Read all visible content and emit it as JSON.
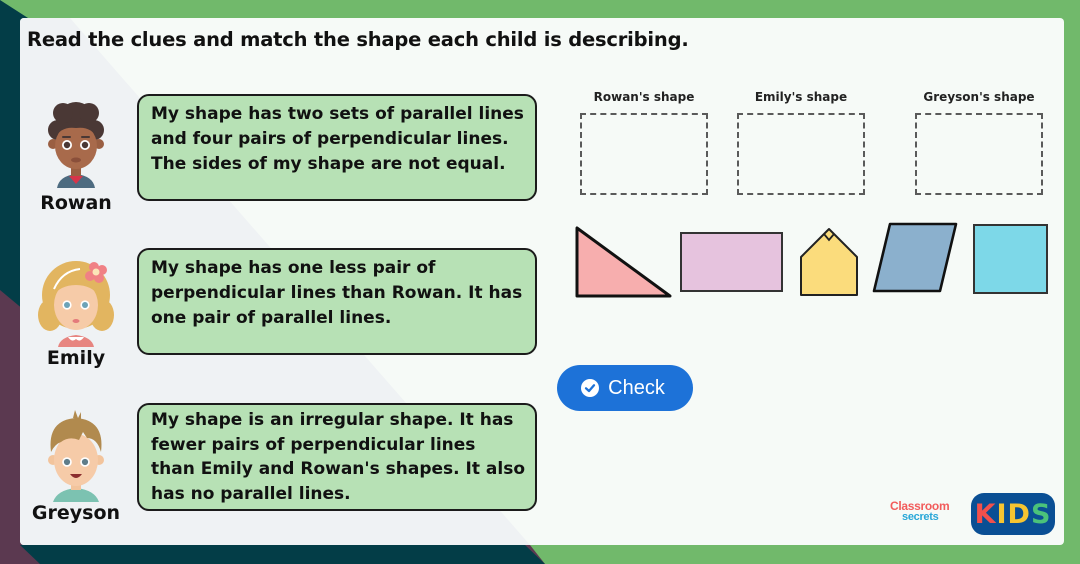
{
  "colors": {
    "frame_green": "#71b96b",
    "frame_teal": "#033d47",
    "frame_plum": "#5b3950",
    "card_bg": "#f6faf7",
    "bubble_bg": "#b7e1b5",
    "check_button": "#1d72d8"
  },
  "title": "Read the clues and match the shape each child is describing.",
  "children": [
    {
      "name": "Rowan",
      "clue": "My shape has two sets of parallel lines and four pairs of perpendicular lines. The sides of my shape are not equal."
    },
    {
      "name": "Emily",
      "clue": "My shape has one less pair of perpendicular lines than Rowan. It has one pair of parallel lines."
    },
    {
      "name": "Greyson",
      "clue": "My shape is an irregular shape. It has fewer pairs of perpendicular lines than Emily and Rowan's shapes. It also has no parallel lines."
    }
  ],
  "drop_slots": [
    {
      "label": "Rowan's shape"
    },
    {
      "label": "Emily's shape"
    },
    {
      "label": "Greyson's shape"
    }
  ],
  "shapes": [
    {
      "name": "right-angled triangle",
      "fill": "#f7aeae"
    },
    {
      "name": "rectangle",
      "fill": "#e6c3de"
    },
    {
      "name": "irregular pentagon",
      "fill": "#fbdc7c"
    },
    {
      "name": "parallelogram",
      "fill": "#8bb0cd"
    },
    {
      "name": "square",
      "fill": "#7dd8e8"
    }
  ],
  "check_button": {
    "label": "Check",
    "icon": "check-circle-icon"
  },
  "branding": {
    "line1": "Classroom",
    "line2": "secrets",
    "kids_letters": [
      {
        "char": "K",
        "color": "#f2504c"
      },
      {
        "char": "I",
        "color": "#f7c531"
      },
      {
        "char": "D",
        "color": "#f7c531"
      },
      {
        "char": "S",
        "color": "#4bc27a"
      }
    ]
  }
}
